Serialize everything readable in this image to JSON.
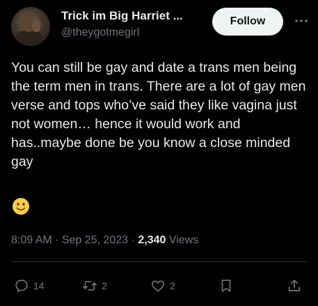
{
  "author": {
    "display_name": "Trick im Big Harriet ...",
    "handle": "@theygotmegirl",
    "avatar_icon": "avatar"
  },
  "follow_label": "Follow",
  "more_icon": "more-dots-icon",
  "tweet": {
    "text": "You can still be gay and date a trans men being the term men in trans. There are a lot of gay men verse and tops who’ve said they like vagina just not women… hence it would work and has..maybe done be you know a close minded gay",
    "emoji": "slightly-smiling-face-emoji"
  },
  "meta": {
    "time": "8:09 AM",
    "sep1": " · ",
    "date": "Sep 25, 2023",
    "sep2": " · ",
    "views_count": "2,340",
    "views_label": " Views"
  },
  "actions": {
    "replies": "14",
    "reposts": "2",
    "likes": "2"
  },
  "colors": {
    "background": "#000000",
    "text": "#e7e9ea",
    "secondary": "#71767b",
    "follow_bg": "#eff3f4",
    "divider": "#2f3336"
  }
}
